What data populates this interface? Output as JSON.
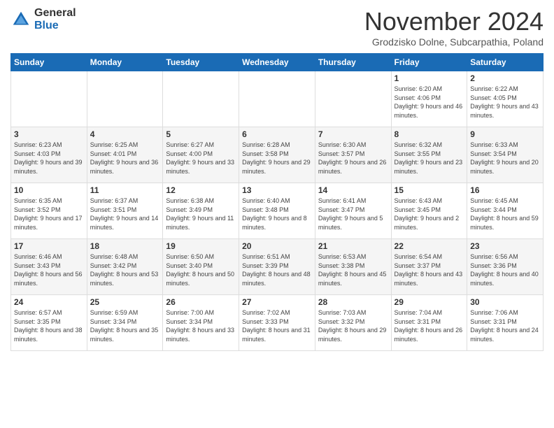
{
  "logo": {
    "general": "General",
    "blue": "Blue"
  },
  "title": "November 2024",
  "location": "Grodzisko Dolne, Subcarpathia, Poland",
  "days_of_week": [
    "Sunday",
    "Monday",
    "Tuesday",
    "Wednesday",
    "Thursday",
    "Friday",
    "Saturday"
  ],
  "weeks": [
    [
      {
        "day": "",
        "info": ""
      },
      {
        "day": "",
        "info": ""
      },
      {
        "day": "",
        "info": ""
      },
      {
        "day": "",
        "info": ""
      },
      {
        "day": "",
        "info": ""
      },
      {
        "day": "1",
        "info": "Sunrise: 6:20 AM\nSunset: 4:06 PM\nDaylight: 9 hours and 46 minutes."
      },
      {
        "day": "2",
        "info": "Sunrise: 6:22 AM\nSunset: 4:05 PM\nDaylight: 9 hours and 43 minutes."
      }
    ],
    [
      {
        "day": "3",
        "info": "Sunrise: 6:23 AM\nSunset: 4:03 PM\nDaylight: 9 hours and 39 minutes."
      },
      {
        "day": "4",
        "info": "Sunrise: 6:25 AM\nSunset: 4:01 PM\nDaylight: 9 hours and 36 minutes."
      },
      {
        "day": "5",
        "info": "Sunrise: 6:27 AM\nSunset: 4:00 PM\nDaylight: 9 hours and 33 minutes."
      },
      {
        "day": "6",
        "info": "Sunrise: 6:28 AM\nSunset: 3:58 PM\nDaylight: 9 hours and 29 minutes."
      },
      {
        "day": "7",
        "info": "Sunrise: 6:30 AM\nSunset: 3:57 PM\nDaylight: 9 hours and 26 minutes."
      },
      {
        "day": "8",
        "info": "Sunrise: 6:32 AM\nSunset: 3:55 PM\nDaylight: 9 hours and 23 minutes."
      },
      {
        "day": "9",
        "info": "Sunrise: 6:33 AM\nSunset: 3:54 PM\nDaylight: 9 hours and 20 minutes."
      }
    ],
    [
      {
        "day": "10",
        "info": "Sunrise: 6:35 AM\nSunset: 3:52 PM\nDaylight: 9 hours and 17 minutes."
      },
      {
        "day": "11",
        "info": "Sunrise: 6:37 AM\nSunset: 3:51 PM\nDaylight: 9 hours and 14 minutes."
      },
      {
        "day": "12",
        "info": "Sunrise: 6:38 AM\nSunset: 3:49 PM\nDaylight: 9 hours and 11 minutes."
      },
      {
        "day": "13",
        "info": "Sunrise: 6:40 AM\nSunset: 3:48 PM\nDaylight: 9 hours and 8 minutes."
      },
      {
        "day": "14",
        "info": "Sunrise: 6:41 AM\nSunset: 3:47 PM\nDaylight: 9 hours and 5 minutes."
      },
      {
        "day": "15",
        "info": "Sunrise: 6:43 AM\nSunset: 3:45 PM\nDaylight: 9 hours and 2 minutes."
      },
      {
        "day": "16",
        "info": "Sunrise: 6:45 AM\nSunset: 3:44 PM\nDaylight: 8 hours and 59 minutes."
      }
    ],
    [
      {
        "day": "17",
        "info": "Sunrise: 6:46 AM\nSunset: 3:43 PM\nDaylight: 8 hours and 56 minutes."
      },
      {
        "day": "18",
        "info": "Sunrise: 6:48 AM\nSunset: 3:42 PM\nDaylight: 8 hours and 53 minutes."
      },
      {
        "day": "19",
        "info": "Sunrise: 6:50 AM\nSunset: 3:40 PM\nDaylight: 8 hours and 50 minutes."
      },
      {
        "day": "20",
        "info": "Sunrise: 6:51 AM\nSunset: 3:39 PM\nDaylight: 8 hours and 48 minutes."
      },
      {
        "day": "21",
        "info": "Sunrise: 6:53 AM\nSunset: 3:38 PM\nDaylight: 8 hours and 45 minutes."
      },
      {
        "day": "22",
        "info": "Sunrise: 6:54 AM\nSunset: 3:37 PM\nDaylight: 8 hours and 43 minutes."
      },
      {
        "day": "23",
        "info": "Sunrise: 6:56 AM\nSunset: 3:36 PM\nDaylight: 8 hours and 40 minutes."
      }
    ],
    [
      {
        "day": "24",
        "info": "Sunrise: 6:57 AM\nSunset: 3:35 PM\nDaylight: 8 hours and 38 minutes."
      },
      {
        "day": "25",
        "info": "Sunrise: 6:59 AM\nSunset: 3:34 PM\nDaylight: 8 hours and 35 minutes."
      },
      {
        "day": "26",
        "info": "Sunrise: 7:00 AM\nSunset: 3:34 PM\nDaylight: 8 hours and 33 minutes."
      },
      {
        "day": "27",
        "info": "Sunrise: 7:02 AM\nSunset: 3:33 PM\nDaylight: 8 hours and 31 minutes."
      },
      {
        "day": "28",
        "info": "Sunrise: 7:03 AM\nSunset: 3:32 PM\nDaylight: 8 hours and 29 minutes."
      },
      {
        "day": "29",
        "info": "Sunrise: 7:04 AM\nSunset: 3:31 PM\nDaylight: 8 hours and 26 minutes."
      },
      {
        "day": "30",
        "info": "Sunrise: 7:06 AM\nSunset: 3:31 PM\nDaylight: 8 hours and 24 minutes."
      }
    ]
  ]
}
